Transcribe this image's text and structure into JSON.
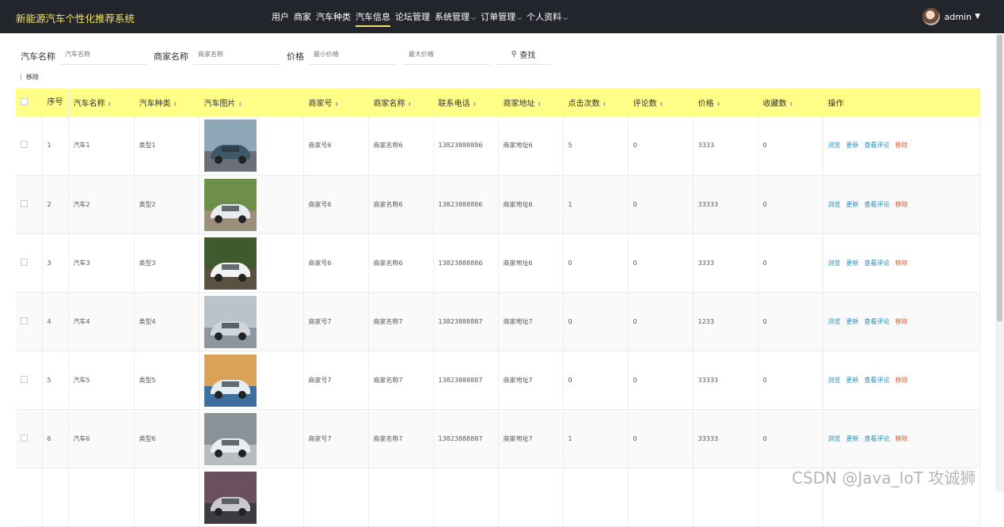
{
  "brand": "新能源汽车个性化推荐系统",
  "nav": [
    {
      "label": "用户",
      "active": false,
      "caret": ""
    },
    {
      "label": "商家",
      "active": false,
      "caret": ""
    },
    {
      "label": "汽车种类",
      "active": false,
      "caret": ""
    },
    {
      "label": "汽车信息",
      "active": true,
      "caret": ""
    },
    {
      "label": "论坛管理",
      "active": false,
      "caret": ""
    },
    {
      "label": "系统管理",
      "active": false,
      "caret": "⌵"
    },
    {
      "label": "订单管理",
      "active": false,
      "caret": "⌵"
    },
    {
      "label": "个人资料",
      "active": false,
      "caret": "⌵"
    }
  ],
  "user": {
    "name": "admin",
    "caret": "▼"
  },
  "search": {
    "car_name_label": "汽车名称",
    "car_name_placeholder": "汽车名称",
    "merchant_name_label": "商家名称",
    "merchant_name_placeholder": "商家名称",
    "price_label": "价格",
    "min_price_placeholder": "最小价格",
    "max_price_placeholder": "最大价格",
    "search_button": "查找",
    "search_icon": "⚲"
  },
  "remove_label": "移除",
  "table": {
    "headers": {
      "index": "序号",
      "car_name": "汽车名称",
      "car_type": "汽车种类",
      "car_image": "汽车图片",
      "merchant_no": "商家号",
      "merchant_name": "商家名称",
      "phone": "联系电话",
      "address": "商家地址",
      "clicks": "点击次数",
      "comments": "评论数",
      "price": "价格",
      "favorites": "收藏数",
      "actions": "操作"
    },
    "sort_icon": "⬍",
    "actions": {
      "view": "浏览",
      "update": "更新",
      "comments": "查看评论",
      "remove": "移除"
    },
    "rows": [
      {
        "index": "1",
        "name": "汽车1",
        "type": "类型1",
        "merchant_no": "商家号6",
        "merchant_name": "商家名称6",
        "phone": "13823888886",
        "address": "商家地址6",
        "clicks": "5",
        "comments": "0",
        "price": "3333",
        "favorites": "0",
        "img": {
          "sky": "#8fa7b6",
          "ground": "#6b7078",
          "car": "#3e5868"
        }
      },
      {
        "index": "2",
        "name": "汽车2",
        "type": "类型2",
        "merchant_no": "商家号6",
        "merchant_name": "商家名称6",
        "phone": "13823888886",
        "address": "商家地址6",
        "clicks": "1",
        "comments": "0",
        "price": "33333",
        "favorites": "0",
        "img": {
          "sky": "#6e8f4a",
          "ground": "#9a8f7a",
          "car": "#e8ecef"
        }
      },
      {
        "index": "3",
        "name": "汽车3",
        "type": "类型3",
        "merchant_no": "商家号6",
        "merchant_name": "商家名称6",
        "phone": "13823888886",
        "address": "商家地址6",
        "clicks": "0",
        "comments": "0",
        "price": "3333",
        "favorites": "0",
        "img": {
          "sky": "#3f5a2c",
          "ground": "#5b5140",
          "car": "#f1f3f2"
        }
      },
      {
        "index": "4",
        "name": "汽车4",
        "type": "类型4",
        "merchant_no": "商家号7",
        "merchant_name": "商家名称7",
        "phone": "13823888887",
        "address": "商家地址7",
        "clicks": "0",
        "comments": "0",
        "price": "1233",
        "favorites": "0",
        "img": {
          "sky": "#b8c3cc",
          "ground": "#8d969e",
          "car": "#cfd7dd"
        }
      },
      {
        "index": "5",
        "name": "汽车5",
        "type": "类型5",
        "merchant_no": "商家号7",
        "merchant_name": "商家名称7",
        "phone": "13823888887",
        "address": "商家地址7",
        "clicks": "0",
        "comments": "0",
        "price": "33333",
        "favorites": "0",
        "img": {
          "sky": "#d9a45a",
          "ground": "#3f6f9e",
          "car": "#e5ecf2"
        }
      },
      {
        "index": "6",
        "name": "汽车6",
        "type": "类型6",
        "merchant_no": "商家号7",
        "merchant_name": "商家名称7",
        "phone": "13823888887",
        "address": "商家地址7",
        "clicks": "1",
        "comments": "0",
        "price": "33333",
        "favorites": "0",
        "img": {
          "sky": "#8a9298",
          "ground": "#b7bcc0",
          "car": "#e9eef1"
        }
      },
      {
        "index": "",
        "name": "",
        "type": "",
        "merchant_no": "",
        "merchant_name": "",
        "phone": "",
        "address": "",
        "clicks": "",
        "comments": "",
        "price": "",
        "favorites": "",
        "img": {
          "sky": "#6a4f5e",
          "ground": "#3e3a44",
          "car": "#c7c9cc"
        },
        "partial": true
      }
    ]
  },
  "watermark": "CSDN @Java_IoT 攻诚狮"
}
